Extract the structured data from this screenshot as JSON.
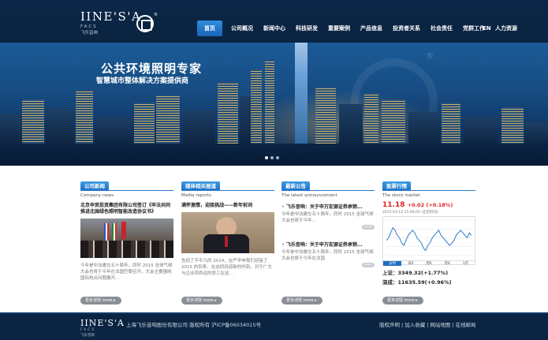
{
  "header": {
    "logo_main": "IINE'S'A",
    "logo_sub": "FACS",
    "logo_sub_cn": "飞乐音响",
    "nav": [
      "首页",
      "公司概况",
      "新闻中心",
      "科技研发",
      "重要案例",
      "产品信息",
      "投资者关系",
      "社会责任",
      "党群工作",
      "人力资源"
    ],
    "nav_active_index": 0,
    "lang": "EN"
  },
  "banner": {
    "title": "公共环境照明专家",
    "subtitle": "智慧城市整体解决方案提供商",
    "registered": "®",
    "slides": 3,
    "active_slide": 0
  },
  "columns": {
    "company_news": {
      "tab": "公司新闻",
      "en": "Company news",
      "headline": "北京申贸投资集团有限公司签订《申法共同推进北国绿色照明智能改造协议书》",
      "body": "今年是中法建交五十周年，同时 2015 全球气候大会也将于今年在法国巴黎召开，大会主要围绕国际热点问题展开...",
      "more": "更多详情 more ▸"
    },
    "media": {
      "tab": "媒体相关报道",
      "en": "Media reports",
      "headline": "满怀激情，迎接挑战——新年祝词",
      "body": "告别了不平凡的 2014，在严辛申我们迎接了 2015 的到来，在这抓旧迎新的时刻，对于广大与企业同命运的员工在这...",
      "more": "更多详情 more ▸"
    },
    "announcements": {
      "tab": "最新公告",
      "en": "The latest announcement",
      "items": [
        {
          "title": "飞乐音响：关于申万宏源证券承销...",
          "desc": "今年是中法建交五十周年，同时 2015 全球气候大会也将于今年..."
        },
        {
          "title": "飞乐音响：关于申万宏源证券承销...",
          "desc": "今年是中法建交五十周年，同时 2015 全球气候大会也将于今年在法国"
        }
      ],
      "item_more": "more",
      "more": "更多详情 more ▸"
    },
    "stock": {
      "tab": "股票行情",
      "en": "The stock market",
      "price": "11.18",
      "change": "+0.02 (+0.18%)",
      "date": "2015-03-12 15:00:01 (北京时间)",
      "tabs": [
        "分时",
        "日K",
        "周K",
        "月K",
        "1年"
      ],
      "active_tab": 0,
      "sh_label": "上证：",
      "sh_value": "3349.32(+1.77%)",
      "sz_label": "深成：",
      "sz_value": "11635.59(+0.96%)",
      "more": "更多详情 more ▸"
    }
  },
  "footer": {
    "logo_main": "IINE'S'A",
    "logo_sub": "FACS",
    "logo_sub_cn": "飞乐音响",
    "copyright": "上海飞乐音响股份有限公司 版权所有 沪ICP备06034015号",
    "links": [
      "版权声明",
      "加入收藏",
      "网站地图",
      "在线邮局"
    ]
  },
  "chart_data": {
    "type": "line",
    "title": "",
    "x": [
      0,
      1,
      2,
      3,
      4,
      5,
      6,
      7,
      8,
      9,
      10,
      11,
      12,
      13,
      14,
      15,
      16,
      17,
      18,
      19,
      20,
      21,
      22,
      23,
      24,
      25,
      26,
      27,
      28,
      29,
      30,
      31,
      32,
      33,
      34,
      35,
      36,
      37,
      38,
      39
    ],
    "series": [
      {
        "values": [
          11.16,
          11.17,
          11.19,
          11.21,
          11.2,
          11.18,
          11.17,
          11.15,
          11.14,
          11.16,
          11.18,
          11.19,
          11.2,
          11.19,
          11.17,
          11.16,
          11.15,
          11.13,
          11.12,
          11.14,
          11.15,
          11.17,
          11.18,
          11.19,
          11.2,
          11.18,
          11.17,
          11.16,
          11.15,
          11.14,
          11.15,
          11.16,
          11.18,
          11.19,
          11.2,
          11.19,
          11.18,
          11.17,
          11.19,
          11.18
        ],
        "color": "#1f6fc1"
      }
    ],
    "ylim": [
      11.1,
      11.24
    ],
    "grid": true,
    "legend": "none"
  }
}
